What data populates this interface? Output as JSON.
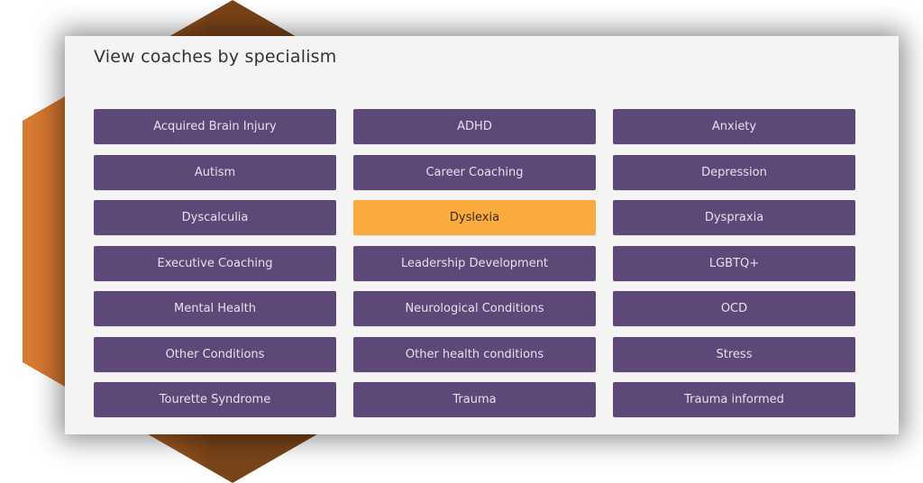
{
  "colors": {
    "button_bg": "#5e4878",
    "button_text": "#e6e0ee",
    "active_bg": "#fbaa3d",
    "active_text": "#3a2a14",
    "card_bg": "#f4f4f4",
    "hexagon_light": "#d97a32",
    "hexagon_dark": "#7a4419"
  },
  "card": {
    "title": "View coaches by specialism"
  },
  "specialisms": [
    {
      "label": "Acquired Brain Injury",
      "active": false
    },
    {
      "label": "ADHD",
      "active": false
    },
    {
      "label": "Anxiety",
      "active": false
    },
    {
      "label": "Autism",
      "active": false
    },
    {
      "label": "Career Coaching",
      "active": false
    },
    {
      "label": "Depression",
      "active": false
    },
    {
      "label": "Dyscalculia",
      "active": false
    },
    {
      "label": "Dyslexia",
      "active": true
    },
    {
      "label": "Dyspraxia",
      "active": false
    },
    {
      "label": "Executive Coaching",
      "active": false
    },
    {
      "label": "Leadership Development",
      "active": false
    },
    {
      "label": "LGBTQ+",
      "active": false
    },
    {
      "label": "Mental Health",
      "active": false
    },
    {
      "label": "Neurological Conditions",
      "active": false
    },
    {
      "label": "OCD",
      "active": false
    },
    {
      "label": "Other Conditions",
      "active": false
    },
    {
      "label": "Other health conditions",
      "active": false
    },
    {
      "label": "Stress",
      "active": false
    },
    {
      "label": "Tourette Syndrome",
      "active": false
    },
    {
      "label": "Trauma",
      "active": false
    },
    {
      "label": "Trauma informed",
      "active": false
    }
  ]
}
